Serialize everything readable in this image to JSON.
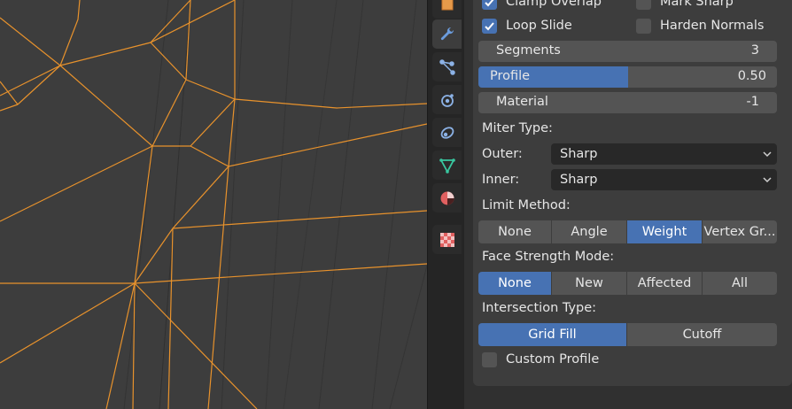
{
  "bevel": {
    "clamp_overlap": {
      "label": "Clamp Overlap",
      "checked": true
    },
    "mark_sharp": {
      "label": "Mark Sharp",
      "checked": false
    },
    "loop_slide": {
      "label": "Loop Slide",
      "checked": true
    },
    "harden_normals": {
      "label": "Harden Normals",
      "checked": false
    },
    "segments": {
      "label": "Segments",
      "value": "3"
    },
    "profile": {
      "label": "Profile",
      "value": "0.50",
      "fraction": 0.5
    },
    "material": {
      "label": "Material",
      "value": "-1"
    },
    "miter_type": {
      "label": "Miter Type:",
      "outer": {
        "label": "Outer:",
        "value": "Sharp"
      },
      "inner": {
        "label": "Inner:",
        "value": "Sharp"
      }
    },
    "limit_method": {
      "label": "Limit Method:",
      "options": [
        "None",
        "Angle",
        "Weight",
        "Vertex Gr..."
      ],
      "selected": "Weight"
    },
    "face_strength_mode": {
      "label": "Face Strength Mode:",
      "options": [
        "None",
        "New",
        "Affected",
        "All"
      ],
      "selected": "None"
    },
    "intersection_type": {
      "label": "Intersection Type:",
      "options": [
        "Grid Fill",
        "Cutoff"
      ],
      "selected": "Grid Fill"
    },
    "custom_profile": {
      "label": "Custom Profile",
      "checked": false
    }
  },
  "tabs": [
    "object-properties-icon",
    "modifier-wrench-icon",
    "particles-icon",
    "physics-icon",
    "constraints-icon",
    "object-data-icon",
    "material-icon",
    "texture-icon"
  ],
  "colors": {
    "accent": "#4772b3",
    "wire": "#e8922c"
  }
}
